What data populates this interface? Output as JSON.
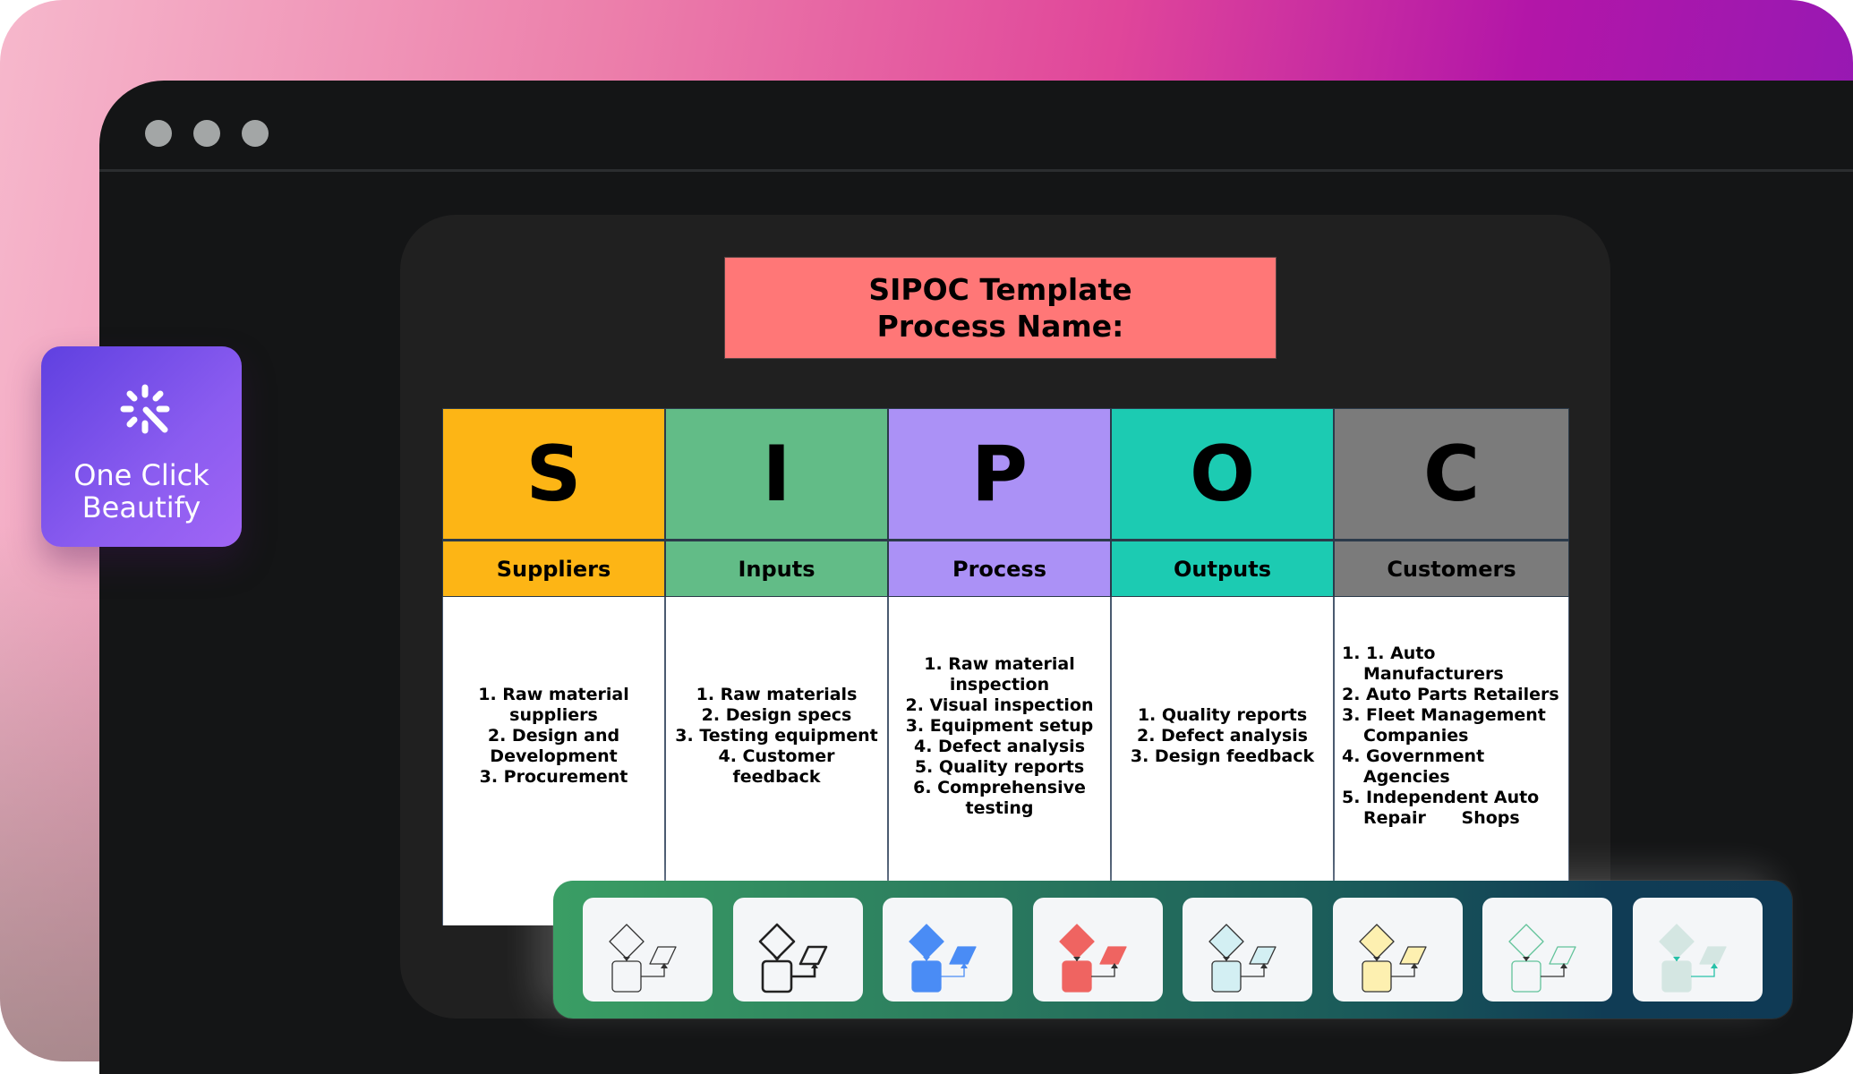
{
  "window": {
    "controls": [
      "window-dot",
      "window-dot",
      "window-dot"
    ]
  },
  "beautify_button": {
    "label_line1": "One Click",
    "label_line2": "Beautify",
    "icon": "magic-wand-sparkle-icon"
  },
  "sipoc": {
    "title_line1": "SIPOC Template",
    "title_line2": "Process Name:",
    "title_color": "#FF7777",
    "columns": [
      {
        "letter": "S",
        "label": "Suppliers",
        "color": "#FDB515",
        "items": [
          "1. Raw material suppliers",
          "2. Design and Development",
          "3. Procurement"
        ]
      },
      {
        "letter": "I",
        "label": "Inputs",
        "color": "#62BC87",
        "items": [
          "1. Raw materials",
          "2. Design specs",
          "3. Testing equipment",
          "4. Customer feedback"
        ]
      },
      {
        "letter": "P",
        "label": "Process",
        "color": "#AB91F6",
        "items": [
          "1. Raw material inspection",
          "2. Visual inspection",
          "3. Equipment setup",
          "4. Defect analysis",
          "5. Quality reports",
          "6. Comprehensive testing"
        ]
      },
      {
        "letter": "O",
        "label": "Outputs",
        "color": "#1CCBB2",
        "items": [
          "1. Quality reports",
          "2. Defect analysis",
          "3. Design feedback"
        ]
      },
      {
        "letter": "C",
        "label": "Customers",
        "color": "#7B7B7B",
        "items": [
          "1. 1. Auto Manufacturers",
          "2. Auto Parts Retailers",
          "3. Fleet Management Companies",
          "4. Government Agencies",
          "5. Independent Auto Repair      Shops"
        ]
      }
    ]
  },
  "style_toolbar": {
    "themes": [
      {
        "name": "outline-thin",
        "fill": "#f4f6f8",
        "stroke": "#333333",
        "connector": "#333333"
      },
      {
        "name": "outline-bold",
        "fill": "#f4f6f8",
        "stroke": "#222222",
        "connector": "#222222"
      },
      {
        "name": "blue-filled",
        "fill": "#4a8cf5",
        "stroke": "#4a8cf5",
        "connector": "#4a8cf5"
      },
      {
        "name": "red-filled",
        "fill": "#ef6461",
        "stroke": "#ef6461",
        "connector": "#333333"
      },
      {
        "name": "light-cyan",
        "fill": "#d3eff3",
        "stroke": "#333333",
        "connector": "#333333"
      },
      {
        "name": "light-yellow",
        "fill": "#fdf0b0",
        "stroke": "#333333",
        "connector": "#333333"
      },
      {
        "name": "green-outline",
        "fill": "#f4f6f8",
        "stroke": "#62c39a",
        "connector": "#333333"
      },
      {
        "name": "pale-teal",
        "fill": "#d4e6e2",
        "stroke": "#d4e6e2",
        "connector": "#27c1a8"
      }
    ]
  }
}
